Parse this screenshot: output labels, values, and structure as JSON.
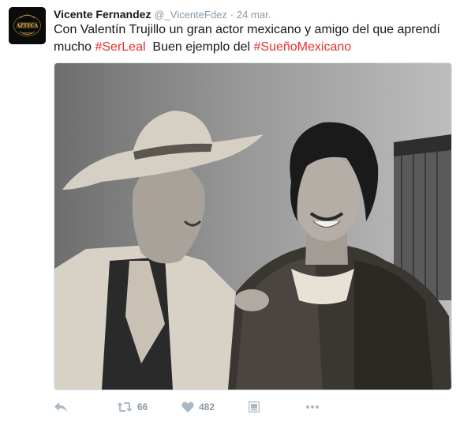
{
  "tweet": {
    "author_name": "Vicente Fernandez",
    "handle": "@_VicenteFdez",
    "separator": "·",
    "timestamp": "24 mar.",
    "text_main": "Con Valentín Trujillo un gran actor mexicano y amigo del que aprendí mucho ",
    "hashtag_1": "#SerLeal",
    "text_mid": "  Buen ejemplo del ",
    "hashtag_2": "#SueñoMexicano",
    "avatar_lettering": "AZTECA",
    "photo_description_icon": "photo"
  },
  "actions": {
    "reply_icon": "reply-icon",
    "retweet_icon": "retweet-icon",
    "retweet_count": "66",
    "like_icon": "heart-icon",
    "like_count": "482",
    "media_icon": "media-icon",
    "more_icon": "more-icon"
  },
  "colors": {
    "hashtag": "#e5302a",
    "muted": "#8899a6",
    "icon": "#aab8c2"
  }
}
